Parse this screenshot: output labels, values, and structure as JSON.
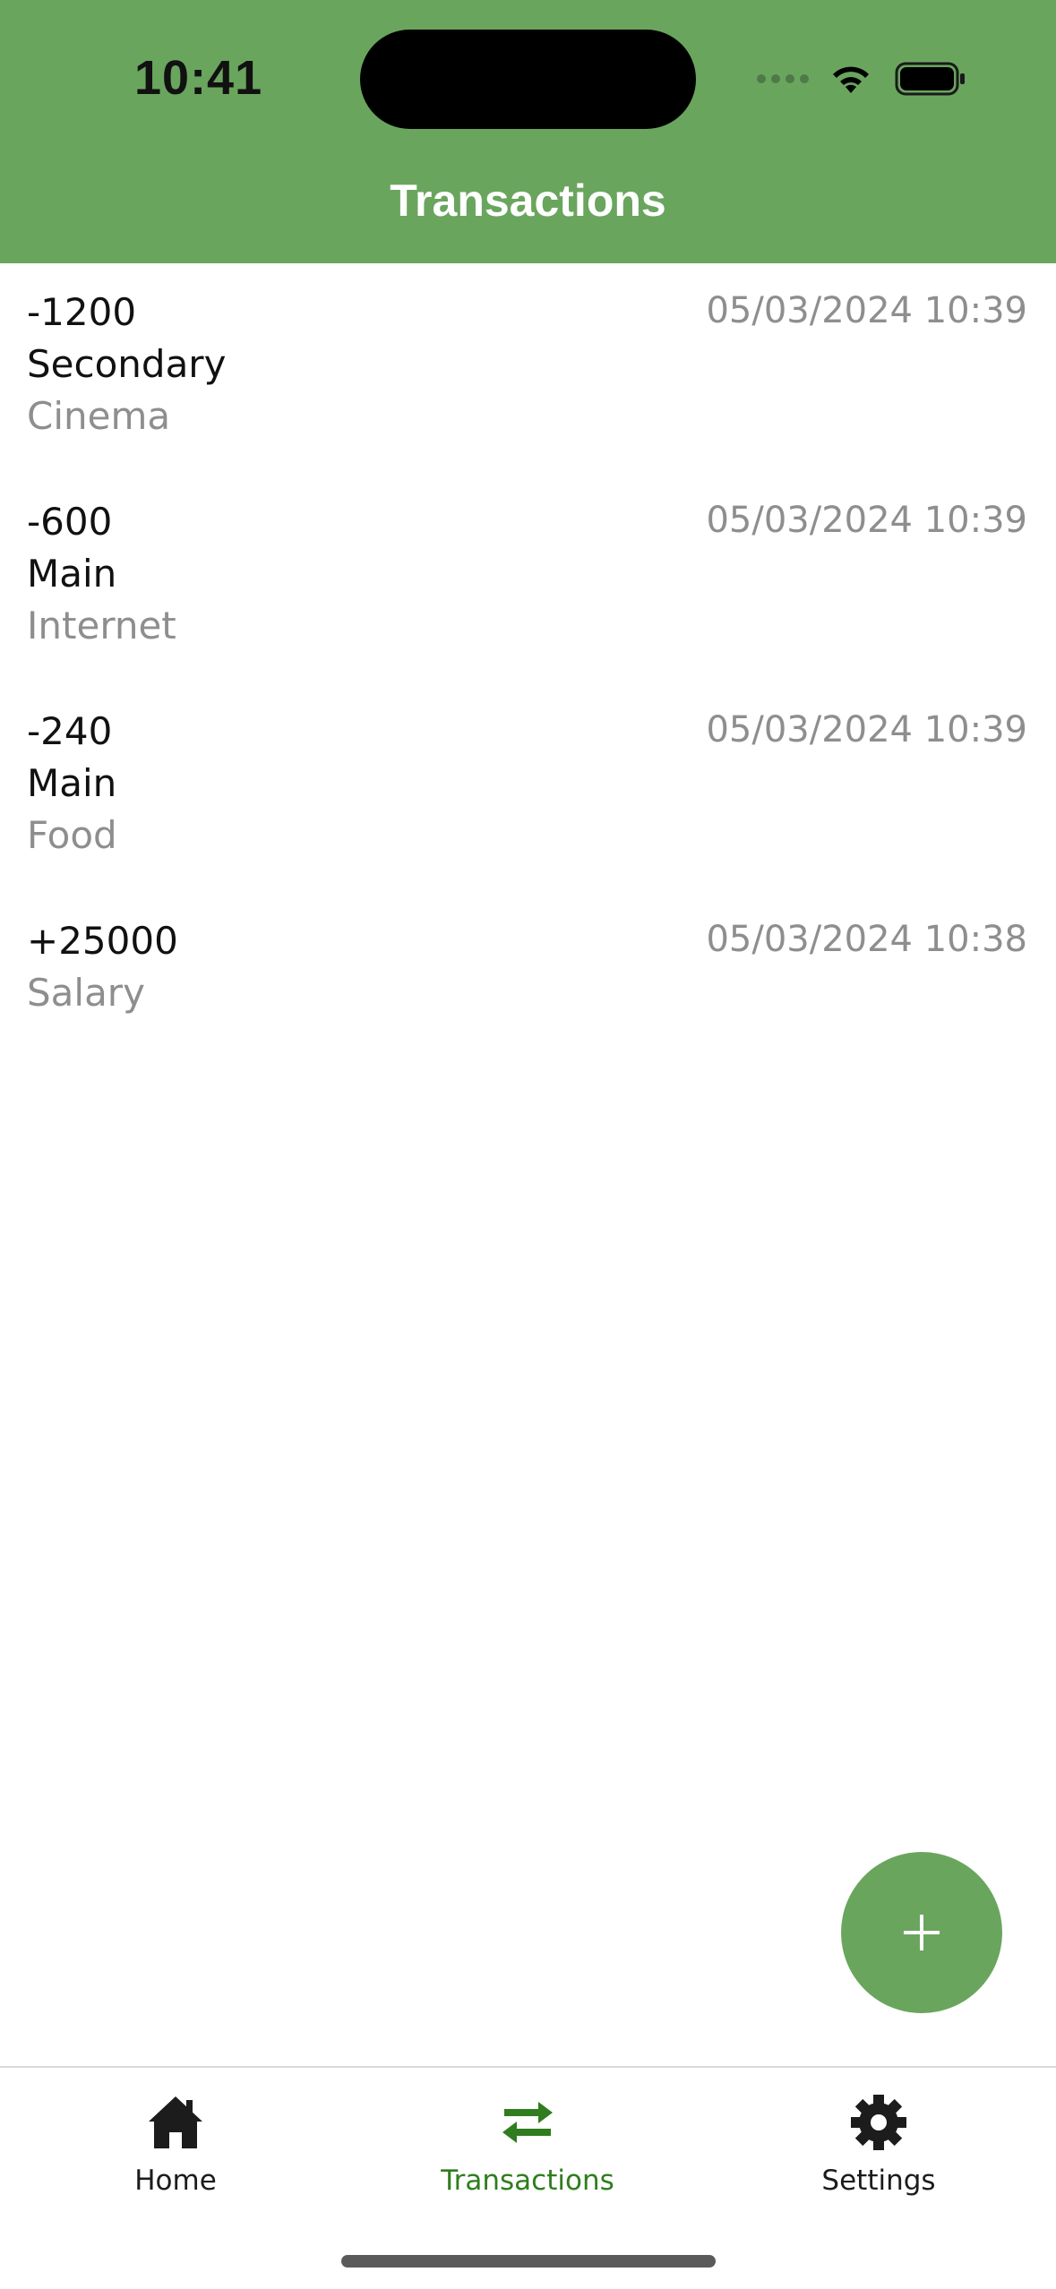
{
  "status_bar": {
    "time": "10:41"
  },
  "header": {
    "title": "Transactions",
    "background": "#6aa55e"
  },
  "transactions": [
    {
      "amount": "-1200",
      "account": "Secondary",
      "category": "Cinema",
      "date": "05/03/2024 10:39"
    },
    {
      "amount": "-600",
      "account": "Main",
      "category": "Internet",
      "date": "05/03/2024 10:39"
    },
    {
      "amount": "-240",
      "account": "Main",
      "category": "Food",
      "date": "05/03/2024 10:39"
    },
    {
      "amount": "+25000",
      "category": "Salary",
      "date": "05/03/2024 10:38"
    }
  ],
  "fab": {
    "icon": "plus-icon",
    "symbol": "+"
  },
  "tabbar": {
    "items": [
      {
        "label": "Home",
        "icon": "home-icon",
        "active": false
      },
      {
        "label": "Transactions",
        "icon": "transfer-arrows-icon",
        "active": true
      },
      {
        "label": "Settings",
        "icon": "gear-icon",
        "active": false
      }
    ],
    "active_color": "#2f7d1e"
  }
}
